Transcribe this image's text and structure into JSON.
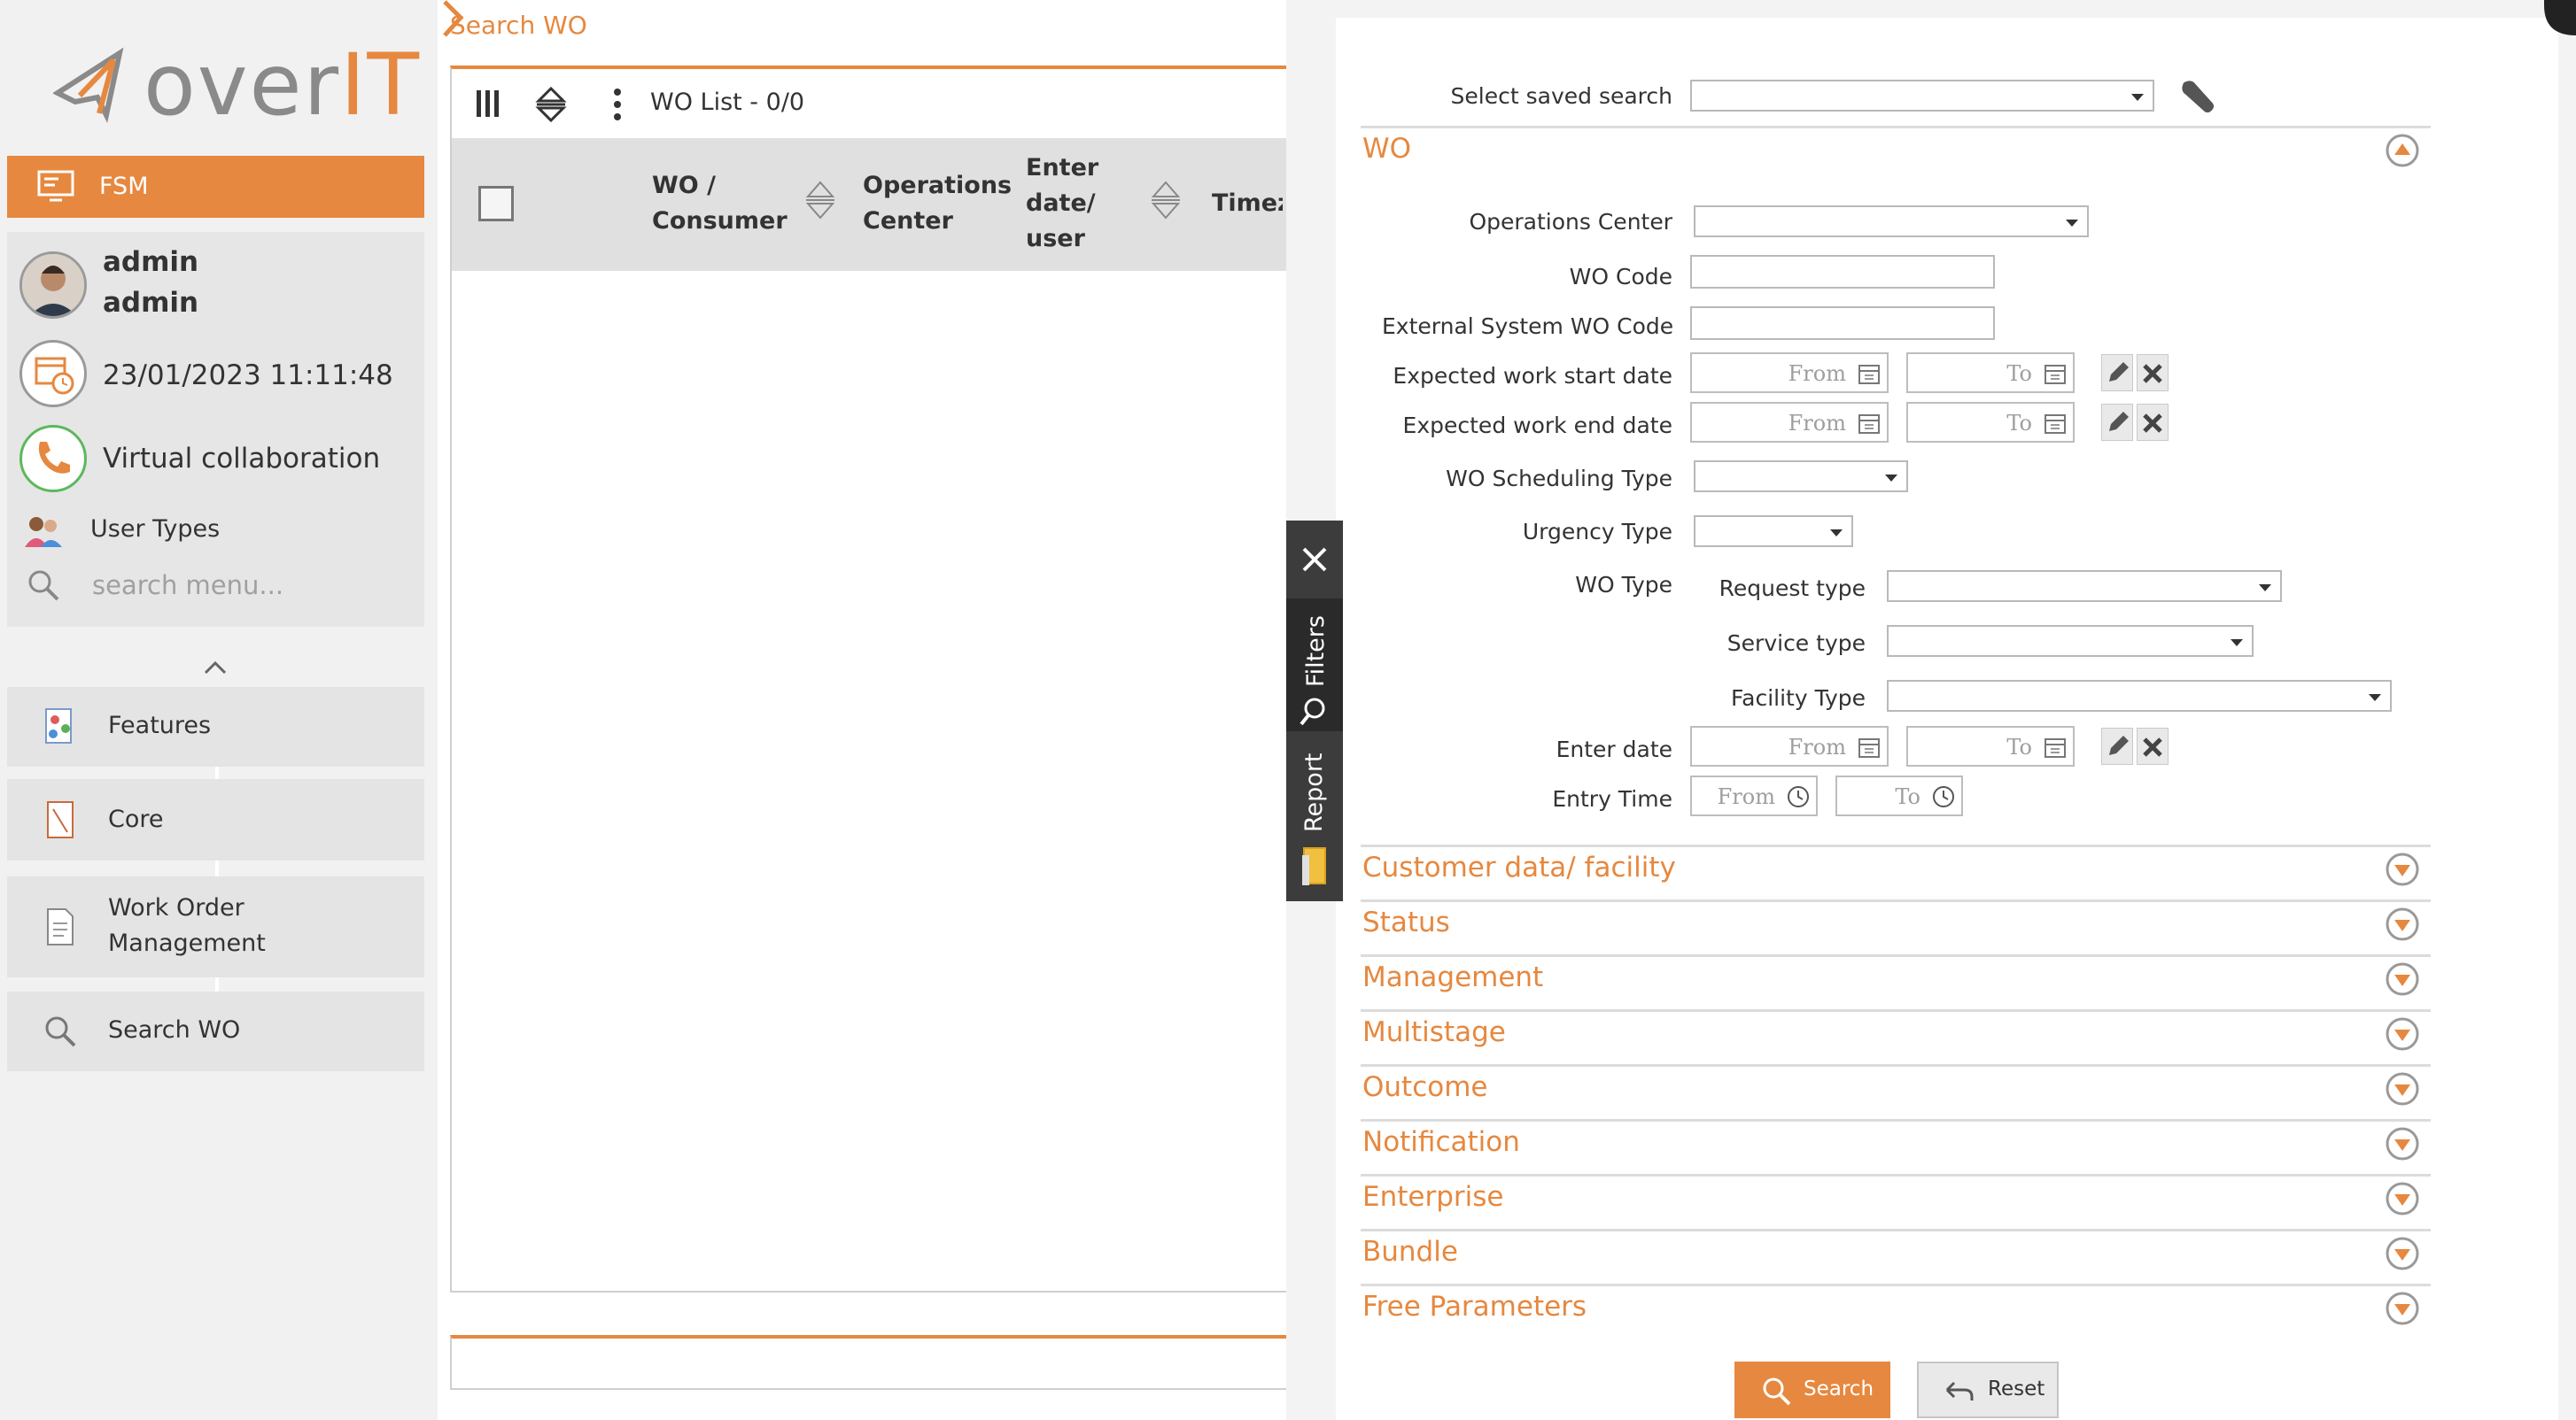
{
  "brand": {
    "logo_text_a": "over",
    "logo_text_b": "IT",
    "accent_color": "#e6883f"
  },
  "sidebar": {
    "app_button": "FSM",
    "user": {
      "first_name": "admin",
      "last_name": "admin"
    },
    "datetime": "23/01/2023 11:11:48",
    "virtual_collaboration": "Virtual collaboration",
    "user_types": "User Types",
    "search_placeholder": "search menu...",
    "menu": [
      {
        "label": "Features",
        "icon": "features-icon"
      },
      {
        "label": "Core",
        "icon": "core-icon"
      },
      {
        "label": "Work Order Management",
        "icon": "document-icon"
      },
      {
        "label": "Search WO",
        "icon": "search-icon"
      }
    ]
  },
  "breadcrumb": "Search WO",
  "wo_list": {
    "title": "WO List - 0/0",
    "columns": [
      "WO / Consumer",
      "Operations Center",
      "Enter date/ user",
      "Timeze"
    ]
  },
  "filters_panel": {
    "tabs": [
      "Filters",
      "Report"
    ],
    "saved_search_label": "Select saved search",
    "wo_section": {
      "title": "WO",
      "fields": {
        "operations_center": "Operations Center",
        "wo_code": "WO Code",
        "external_code": "External System WO Code",
        "exp_start": "Expected work start date",
        "exp_end": "Expected work end date",
        "scheduling_type": "WO Scheduling Type",
        "urgency_type": "Urgency Type",
        "wo_type": "WO Type",
        "request_type": "Request type",
        "service_type": "Service type",
        "facility_type": "Facility Type",
        "enter_date": "Enter date",
        "entry_time": "Entry Time"
      },
      "from_placeholder": "From",
      "to_placeholder": "To"
    },
    "sections": [
      "Customer data/ facility",
      "Status",
      "Management",
      "Multistage",
      "Outcome",
      "Notification",
      "Enterprise",
      "Bundle",
      "Free Parameters"
    ],
    "search_button": "Search",
    "reset_button": "Reset"
  }
}
